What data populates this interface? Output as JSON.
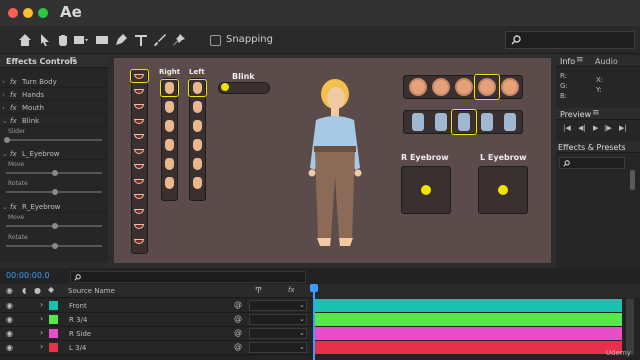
{
  "app": {
    "title": "Ae"
  },
  "window_controls": {
    "close_color": "#ff5f57",
    "minimize_color": "#febc2e",
    "zoom_color": "#28c840"
  },
  "toolbar": {
    "snapping_label": "Snapping",
    "tools": [
      "home-icon",
      "selection-icon",
      "hand-icon",
      "zoom-icon",
      "rectangle-icon",
      "pen-icon",
      "type-icon",
      "brush-icon",
      "puppet-pin-icon"
    ]
  },
  "effects_panel": {
    "title": "Effects Controls",
    "items": [
      {
        "prefix": "fx",
        "label": "Turn Body"
      },
      {
        "prefix": "fx",
        "label": "Hands"
      },
      {
        "prefix": "fx",
        "label": "Mouth"
      },
      {
        "prefix": "fx",
        "label": "Blink"
      }
    ],
    "blink_slider_label": "Slider",
    "l_eyebrow": {
      "label": "L_Eyebrow",
      "move": "Move",
      "rotate": "Rotate"
    },
    "r_eyebrow": {
      "label": "R_Eyebrow",
      "move": "Move",
      "rotate": "Rotate"
    }
  },
  "canvas": {
    "hands_right_label": "Right",
    "hands_left_label": "Left",
    "blink_label": "Blink",
    "r_eyebrow_label": "R Eyebrow",
    "l_eyebrow_label": "L Eyebrow",
    "bg_color": "#5b4c4b",
    "accent_yellow": "#f2e400"
  },
  "right_panels": {
    "info_tab": "Info",
    "audio_tab": "Audio",
    "info_values": {
      "r": "R:",
      "g": "G:",
      "b": "B:",
      "x": "X:",
      "y": "Y:"
    },
    "preview_title": "Preview",
    "effects_presets_title": "Effects & Presets"
  },
  "timeline": {
    "timecode": "00:00:00.0",
    "source_name_header": "Source Name",
    "layers": [
      {
        "name": "Front",
        "color": "#19c2b0"
      },
      {
        "name": "R 3/4",
        "color": "#56e84a"
      },
      {
        "name": "R Side",
        "color": "#e84ec8"
      },
      {
        "name": "L 3/4",
        "color": "#e8304c"
      }
    ]
  },
  "watermark": "Udemy"
}
